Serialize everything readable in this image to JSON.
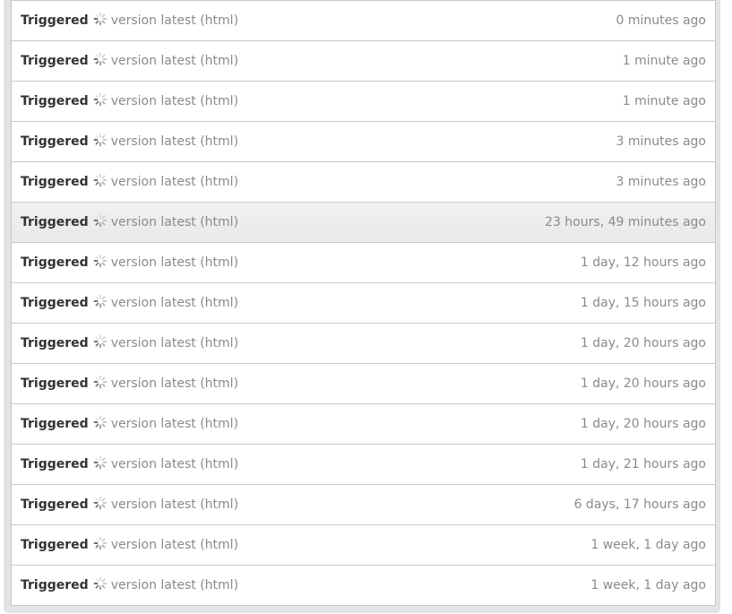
{
  "builds": {
    "status_label": "Triggered",
    "spinner_icon": "loading-spinner-icon",
    "items": [
      {
        "version": "version latest (html)",
        "time": "0 minutes ago",
        "highlighted": false
      },
      {
        "version": "version latest (html)",
        "time": "1 minute ago",
        "highlighted": false
      },
      {
        "version": "version latest (html)",
        "time": "1 minute ago",
        "highlighted": false
      },
      {
        "version": "version latest (html)",
        "time": "3 minutes ago",
        "highlighted": false
      },
      {
        "version": "version latest (html)",
        "time": "3 minutes ago",
        "highlighted": false
      },
      {
        "version": "version latest (html)",
        "time": "23 hours, 49 minutes ago",
        "highlighted": true
      },
      {
        "version": "version latest (html)",
        "time": "1 day, 12 hours ago",
        "highlighted": false
      },
      {
        "version": "version latest (html)",
        "time": "1 day, 15 hours ago",
        "highlighted": false
      },
      {
        "version": "version latest (html)",
        "time": "1 day, 20 hours ago",
        "highlighted": false
      },
      {
        "version": "version latest (html)",
        "time": "1 day, 20 hours ago",
        "highlighted": false
      },
      {
        "version": "version latest (html)",
        "time": "1 day, 20 hours ago",
        "highlighted": false
      },
      {
        "version": "version latest (html)",
        "time": "1 day, 21 hours ago",
        "highlighted": false
      },
      {
        "version": "version latest (html)",
        "time": "6 days, 17 hours ago",
        "highlighted": false
      },
      {
        "version": "version latest (html)",
        "time": "1 week, 1 day ago",
        "highlighted": false
      },
      {
        "version": "version latest (html)",
        "time": "1 week, 1 day ago",
        "highlighted": false
      }
    ]
  }
}
